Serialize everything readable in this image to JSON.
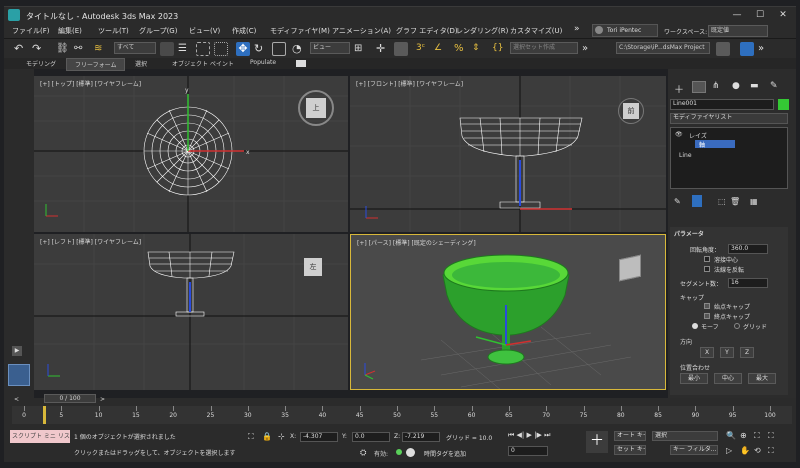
{
  "window": {
    "title": "タイトルなし - Autodesk 3ds Max 2023",
    "minimize": "—",
    "maximize": "☐",
    "close": "✕"
  },
  "menu": [
    "ファイル(F)",
    "編集(E)",
    "ツール(T)",
    "グループ(G)",
    "ビュー(V)",
    "作成(C)",
    "モディファイヤ(M)",
    "アニメーション(A)",
    "グラフ エディタ(D)",
    "レンダリング(R)",
    "カスタマイズ(U)"
  ],
  "menu_more": "»",
  "user": "Tori iPentec",
  "workspace": {
    "label": "ワークスペース:",
    "value": "既定値"
  },
  "toolbar": {
    "selection_filter": "すべて",
    "ref_coord": "ビュー",
    "named_selection": "選択セット作成",
    "project_path": "C:\\Storage\\iP...dsMax Project"
  },
  "ribbon": {
    "tabs": [
      "モデリング",
      "フリーフォーム",
      "選択",
      "オブジェクト ペイント",
      "Populate"
    ]
  },
  "viewports": {
    "top": "[+] [トップ] [標準] [ワイヤフレーム]",
    "front": "[+] [フロント] [標準] [ワイヤフレーム]",
    "left": "[+] [レフト] [標準] [ワイヤフレーム]",
    "perspective": "[+] [パース] [標準] [既定のシェーディング]",
    "cube_top": "上",
    "cube_front": "前",
    "cube_left": "左"
  },
  "command_panel": {
    "object_name": "Line001",
    "object_color": "#34c934",
    "modifier_list": "モディファイヤリスト",
    "stack": [
      "レイズ",
      "軸",
      "Line"
    ],
    "rollout_title": "パラメータ",
    "rotation_label": "回転角度：",
    "rotation_value": "360.0",
    "weld_core": "溶接中心",
    "flip_normals": "法線を反転",
    "segments_label": "セグメント数：",
    "segments_value": "16",
    "capping_label": "キャップ",
    "cap_start": "始点キャップ",
    "cap_end": "終点キャップ",
    "morph": "モーフ",
    "grid": "グリッド",
    "direction_label": "方向",
    "dir_x": "X",
    "dir_y": "Y",
    "dir_z": "Z",
    "align_label": "位置合わせ",
    "align_min": "最小",
    "align_center": "中心",
    "align_max": "最大"
  },
  "timeline": {
    "frame": "0 / 100",
    "ticks": [
      "0",
      "5",
      "10",
      "15",
      "20",
      "25",
      "30",
      "35",
      "40",
      "45",
      "50",
      "55",
      "60",
      "65",
      "70",
      "75",
      "80",
      "85",
      "90",
      "95",
      "100"
    ],
    "marker_fraction": 0.0
  },
  "status": {
    "script_label": "スクリプト ミニ リス",
    "line1": "1 個のオブジェクトが選択されました",
    "line2": "クリックまたはドラッグをして、オブジェクトを選択します",
    "x_label": "X:",
    "x_value": "-4.307",
    "y_label": "Y:",
    "y_value": "0.0",
    "z_label": "Z:",
    "z_value": "-7.219",
    "grid": "グリッド = 10.0",
    "enabled": "有効:",
    "add_tag": "時間タグを追加",
    "auto_key": "オート キー",
    "set_key": "セット キー",
    "selection": "選択",
    "key_filter": "キー フィルタ...",
    "frame_value": "0"
  }
}
